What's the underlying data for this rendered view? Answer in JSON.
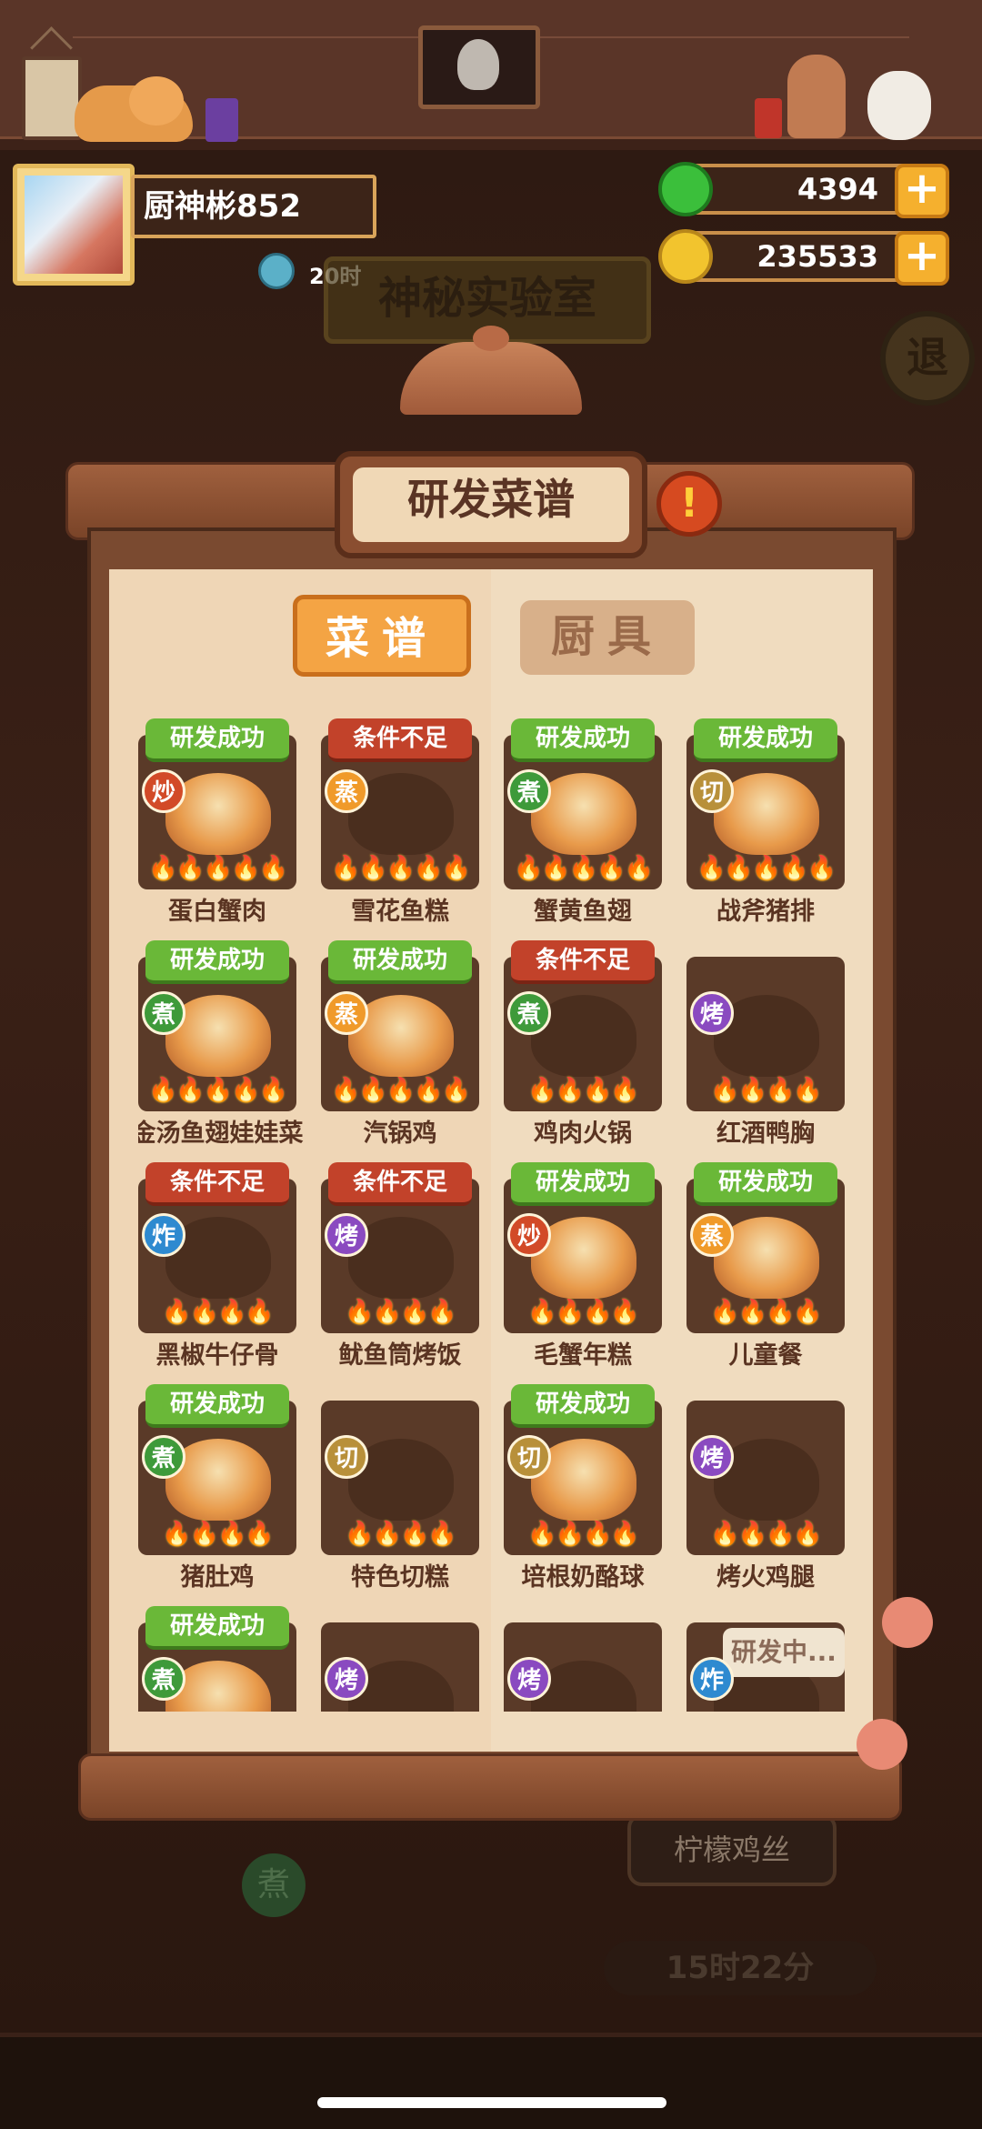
{
  "player": {
    "name": "厨神彬852",
    "timer_text": "20时"
  },
  "resources": {
    "jade": "4394",
    "coins": "235533",
    "add_symbol": "+"
  },
  "background": {
    "lab_title": "神秘实验室",
    "back_label": "退",
    "bg_button": "柠檬鸡丝",
    "bg_timer": "15时22分",
    "bg_method": "煮"
  },
  "panel": {
    "title": "研发菜谱",
    "alert": "!",
    "tabs": [
      {
        "label": "菜谱",
        "active": true
      },
      {
        "label": "厨具",
        "active": false
      }
    ]
  },
  "dishes": [
    {
      "name": "蛋白蟹肉",
      "status": "研发成功",
      "method": "炒",
      "flames": "🔥🔥🔥🔥🔥"
    },
    {
      "name": "雪花鱼糕",
      "status": "条件不足",
      "method": "蒸",
      "flames": "🔥🔥🔥🔥🔥"
    },
    {
      "name": "蟹黄鱼翅",
      "status": "研发成功",
      "method": "煮",
      "flames": "🔥🔥🔥🔥🔥"
    },
    {
      "name": "战斧猪排",
      "status": "研发成功",
      "method": "切",
      "flames": "🔥🔥🔥🔥🔥"
    },
    {
      "name": "金汤鱼翅娃娃菜",
      "status": "研发成功",
      "method": "煮",
      "flames": "🔥🔥🔥🔥🔥"
    },
    {
      "name": "汽锅鸡",
      "status": "研发成功",
      "method": "蒸",
      "flames": "🔥🔥🔥🔥🔥"
    },
    {
      "name": "鸡肉火锅",
      "status": "条件不足",
      "method": "煮",
      "flames": "🔥🔥🔥🔥"
    },
    {
      "name": "红酒鸭胸",
      "status": "",
      "method": "烤",
      "flames": "🔥🔥🔥🔥"
    },
    {
      "name": "黑椒牛仔骨",
      "status": "条件不足",
      "method": "炸",
      "flames": "🔥🔥🔥🔥"
    },
    {
      "name": "鱿鱼筒烤饭",
      "status": "条件不足",
      "method": "烤",
      "flames": "🔥🔥🔥🔥"
    },
    {
      "name": "毛蟹年糕",
      "status": "研发成功",
      "method": "炒",
      "flames": "🔥🔥🔥🔥"
    },
    {
      "name": "儿童餐",
      "status": "研发成功",
      "method": "蒸",
      "flames": "🔥🔥🔥🔥"
    },
    {
      "name": "猪肚鸡",
      "status": "研发成功",
      "method": "煮",
      "flames": "🔥🔥🔥🔥"
    },
    {
      "name": "特色切糕",
      "status": "",
      "method": "切",
      "flames": "🔥🔥🔥🔥"
    },
    {
      "name": "培根奶酪球",
      "status": "研发成功",
      "method": "切",
      "flames": "🔥🔥🔥🔥"
    },
    {
      "name": "烤火鸡腿",
      "status": "",
      "method": "烤",
      "flames": "🔥🔥🔥🔥"
    },
    {
      "name": "",
      "status": "研发成功",
      "method": "煮",
      "flames": ""
    },
    {
      "name": "",
      "status": "",
      "method": "烤",
      "flames": ""
    },
    {
      "name": "",
      "status": "",
      "method": "烤",
      "flames": ""
    },
    {
      "name": "",
      "status": "",
      "method": "炸",
      "flames": "",
      "progress": "研发中..."
    }
  ],
  "icons": {
    "jade": "jade-icon",
    "coin": "coin-icon",
    "timer": "clock-icon",
    "alert": "alert-icon"
  }
}
